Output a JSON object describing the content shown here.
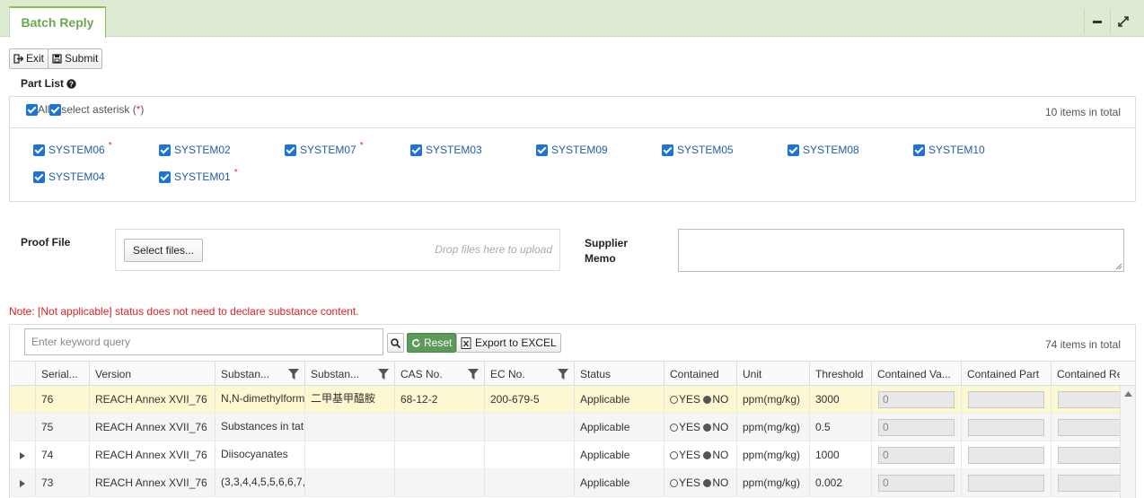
{
  "header": {
    "tab_label": "Batch Reply"
  },
  "toolbar": {
    "exit_label": "Exit",
    "submit_label": "Submit"
  },
  "part_list": {
    "title": "Part List",
    "all_label": "All",
    "select_asterisk_label": "select asterisk (",
    "asterisk": "*",
    "close_paren": " )",
    "total": "10 items in total",
    "items": [
      {
        "label": "SYSTEM06",
        "star": "*"
      },
      {
        "label": "SYSTEM02",
        "star": ""
      },
      {
        "label": "SYSTEM07",
        "star": "*"
      },
      {
        "label": "SYSTEM03",
        "star": ""
      },
      {
        "label": "SYSTEM09",
        "star": ""
      },
      {
        "label": "SYSTEM05",
        "star": ""
      },
      {
        "label": "SYSTEM08",
        "star": ""
      },
      {
        "label": "SYSTEM10",
        "star": ""
      },
      {
        "label": "SYSTEM04",
        "star": ""
      },
      {
        "label": "SYSTEM01",
        "star": "*"
      }
    ]
  },
  "proof": {
    "label": "Proof File",
    "select_label": "Select files...",
    "drop_hint": "Drop files here to upload"
  },
  "memo": {
    "label_line1": "Supplier",
    "label_line2": "Memo"
  },
  "note": "Note: [Not applicable] status does not need to declare substance content.",
  "grid": {
    "search_placeholder": "Enter keyword query",
    "reset_label": "Reset",
    "export_label": "Export to EXCEL",
    "total": "74 items in total",
    "columns": [
      "Serial...",
      "Version",
      "Substan...",
      "Substan...",
      "CAS No.",
      "EC No.",
      "Status",
      "Contained",
      "Unit",
      "Threshold",
      "Contained Va...",
      "Contained Part",
      "Contained Re"
    ],
    "yes_label": "YES",
    "no_label": "NO",
    "rows": [
      {
        "serial": "76",
        "version": "REACH Annex XVII_76",
        "sub1": "N,N-dimethylform",
        "sub2": "二甲基甲醯胺",
        "cas": "68-12-2",
        "ec": "200-679-5",
        "status": "Applicable",
        "unit": "ppm(mg/kg)",
        "threshold": "3000",
        "value": "0"
      },
      {
        "serial": "75",
        "version": "REACH Annex XVII_76",
        "sub1": "Substances in tat",
        "sub2": "",
        "cas": "",
        "ec": "",
        "status": "Applicable",
        "unit": "ppm(mg/kg)",
        "threshold": "0.5",
        "value": "0"
      },
      {
        "serial": "74",
        "version": "REACH Annex XVII_76",
        "sub1": "Diisocyanates",
        "sub2": "",
        "cas": "",
        "ec": "",
        "status": "Applicable",
        "unit": "ppm(mg/kg)",
        "threshold": "1000",
        "value": "0"
      },
      {
        "serial": "73",
        "version": "REACH Annex XVII_76",
        "sub1": "(3,3,4,4,5,5,6,6,7,",
        "sub2": "",
        "cas": "",
        "ec": "",
        "status": "Applicable",
        "unit": "ppm(mg/kg)",
        "threshold": "0.002",
        "value": "0"
      }
    ]
  },
  "colors": {
    "accent": "#8cc152",
    "header_bg": "#dcebd2",
    "selected_row": "#fcf8d2",
    "link": "#1f5fa6",
    "note": "#e02020"
  }
}
